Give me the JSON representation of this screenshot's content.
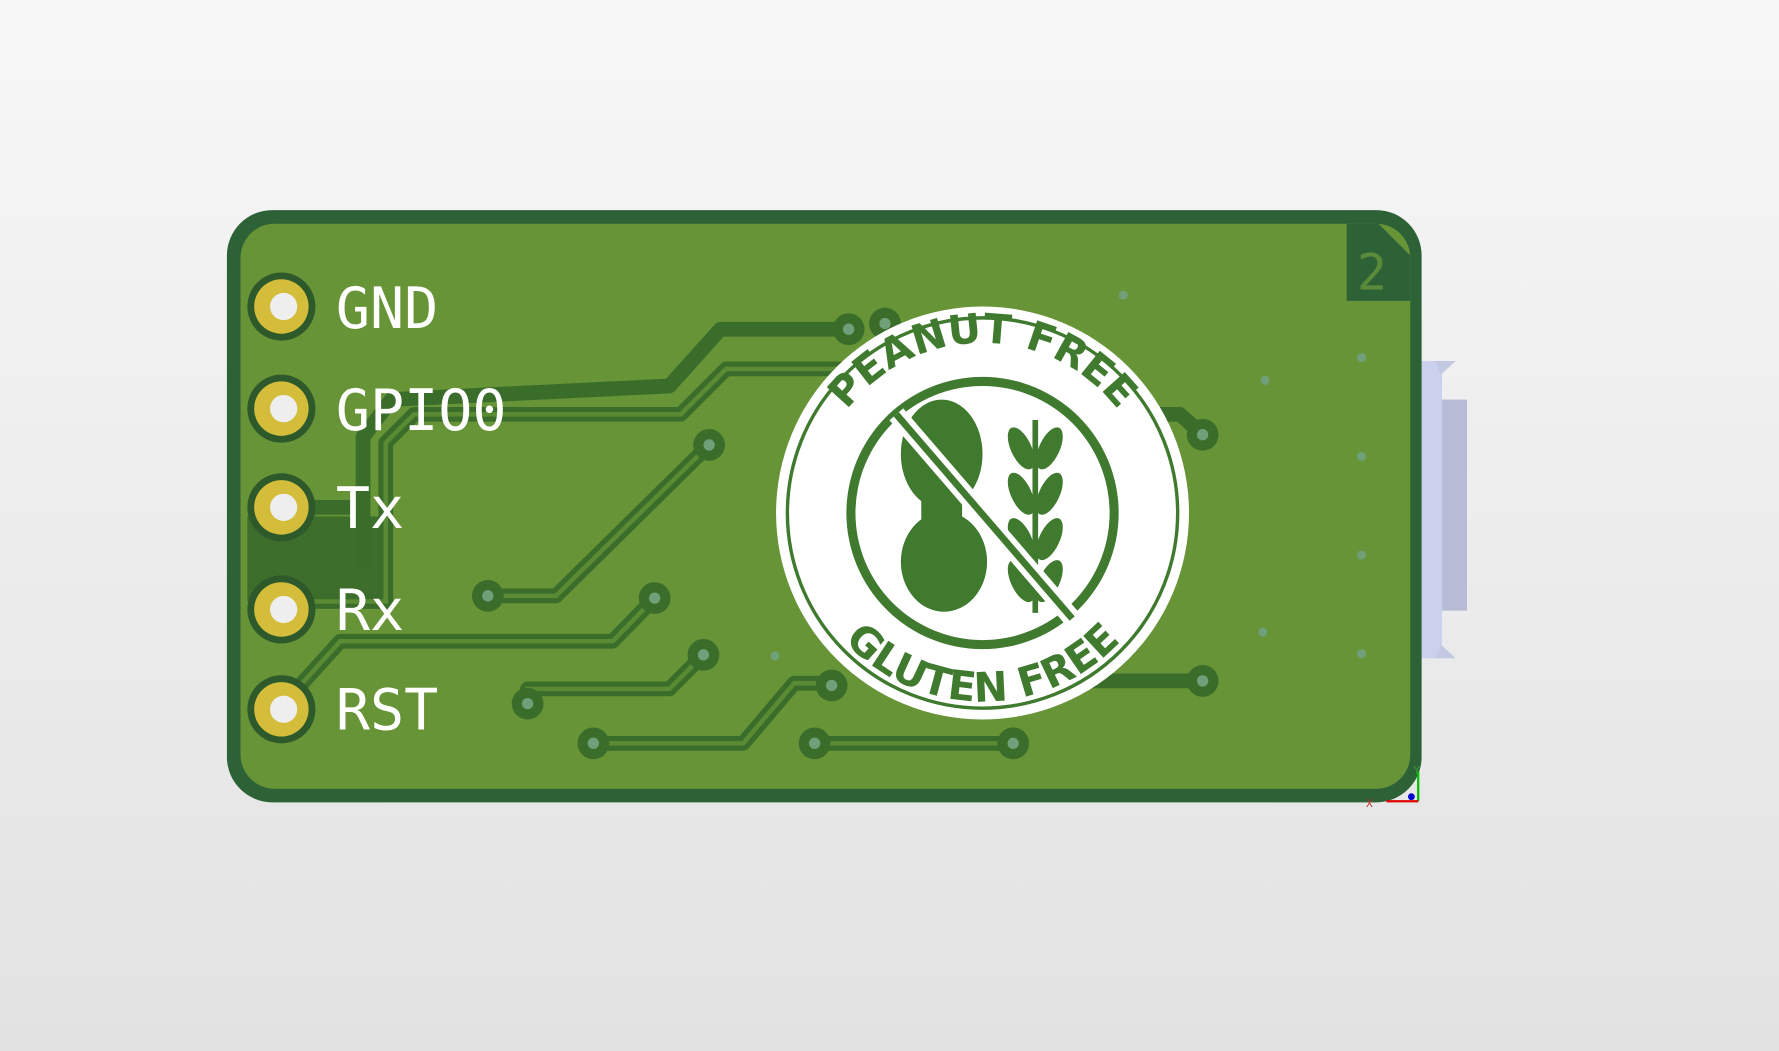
{
  "board": {
    "pin_labels": [
      "GND",
      "GPIO0",
      "Tx",
      "Rx",
      "RST"
    ],
    "layer_marker": "2",
    "logo": {
      "top_text": "PEANUT FREE",
      "bottom_text": "GLUTEN FREE"
    },
    "axes": {
      "x": "X",
      "y": "Y"
    }
  },
  "colors": {
    "board": "#679436",
    "board_edge": "#2b5e33",
    "trace": "#3d7029",
    "pad": "#d3bd3b",
    "silkscreen": "#ffffff",
    "connector": "#cbd1ec"
  }
}
